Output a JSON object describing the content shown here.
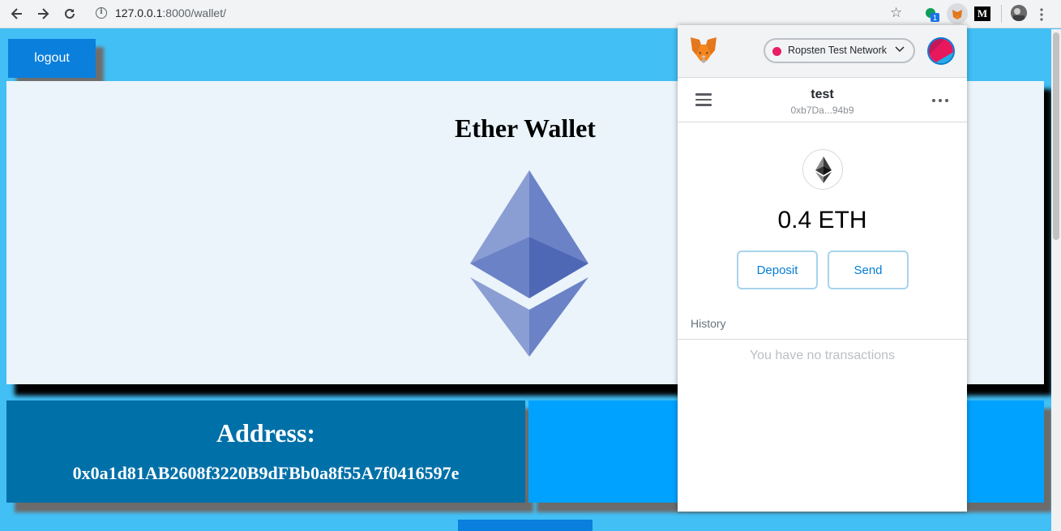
{
  "browser": {
    "url_host": "127.0.0.1",
    "url_path": ":8000/wallet/",
    "extension_badge": "1",
    "medium_label": "M",
    "icons": [
      "back-icon",
      "forward-icon",
      "reload-icon",
      "info-icon",
      "star-icon"
    ]
  },
  "page": {
    "logout_label": "logout",
    "title": "Ether Wallet",
    "address_title": "Address:",
    "address_value": "0x0a1d81AB2608f3220B9dFBb0a8f55A7f0416597e"
  },
  "metamask": {
    "network": "Ropsten Test Network",
    "account_name": "test",
    "account_address": "0xb7Da...94b9",
    "balance": "0.4 ETH",
    "deposit_label": "Deposit",
    "send_label": "Send",
    "history_label": "History",
    "empty_history": "You have no transactions",
    "colors": {
      "network_dot": "#e91e63",
      "accent": "#037dd6"
    }
  },
  "colors": {
    "page_background": "#42bff5",
    "button_blue": "#0a7fdc",
    "address_panel": "#0070a8",
    "balance_panel": "#00a2ff"
  }
}
